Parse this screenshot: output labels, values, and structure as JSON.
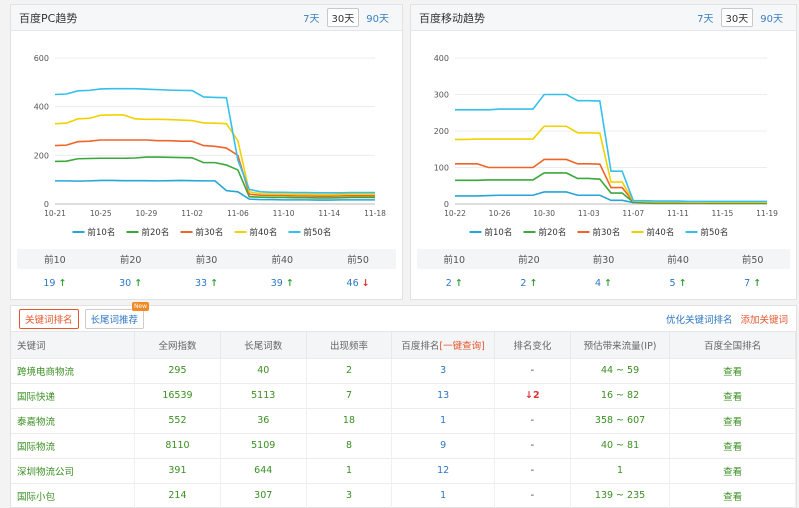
{
  "pc_panel": {
    "title": "百度PC趋势",
    "ranges": [
      "7天",
      "30天",
      "90天"
    ],
    "active_range": "30天",
    "rank_headers": [
      "前10",
      "前20",
      "前30",
      "前40",
      "前50"
    ],
    "rank_values": [
      {
        "value": "19",
        "trend": "up"
      },
      {
        "value": "30",
        "trend": "up"
      },
      {
        "value": "33",
        "trend": "up"
      },
      {
        "value": "39",
        "trend": "up"
      },
      {
        "value": "46",
        "trend": "down"
      }
    ]
  },
  "mobile_panel": {
    "title": "百度移动趋势",
    "ranges": [
      "7天",
      "30天",
      "90天"
    ],
    "active_range": "30天",
    "rank_headers": [
      "前10",
      "前20",
      "前30",
      "前40",
      "前50"
    ],
    "rank_values": [
      {
        "value": "2",
        "trend": "up"
      },
      {
        "value": "2",
        "trend": "up"
      },
      {
        "value": "4",
        "trend": "up"
      },
      {
        "value": "5",
        "trend": "up"
      },
      {
        "value": "7",
        "trend": "up"
      }
    ]
  },
  "chart_data": [
    {
      "type": "line",
      "x": [
        "10-21",
        "10-22",
        "10-23",
        "10-24",
        "10-25",
        "10-26",
        "10-27",
        "10-28",
        "10-29",
        "10-30",
        "10-31",
        "11-01",
        "11-02",
        "11-03",
        "11-04",
        "11-05",
        "11-06",
        "11-07",
        "11-08",
        "11-09",
        "11-10",
        "11-11",
        "11-12",
        "11-13",
        "11-14",
        "11-15",
        "11-16",
        "11-17",
        "11-18"
      ],
      "x_ticks": [
        "10-21",
        "10-25",
        "10-29",
        "11-02",
        "11-06",
        "11-10",
        "11-14",
        "11-18"
      ],
      "ylim": [
        0,
        600
      ],
      "y_ticks": [
        0,
        200,
        400,
        600
      ],
      "series": [
        {
          "name": "前10名",
          "color": "#26a6d6",
          "values": [
            95,
            95,
            94,
            95,
            97,
            97,
            96,
            96,
            96,
            95,
            96,
            97,
            96,
            95,
            95,
            55,
            50,
            20,
            18,
            18,
            17,
            17,
            17,
            16,
            16,
            17,
            17,
            17,
            17
          ]
        },
        {
          "name": "前20名",
          "color": "#3aa83a",
          "values": [
            175,
            176,
            186,
            187,
            188,
            188,
            188,
            189,
            193,
            193,
            192,
            191,
            190,
            170,
            170,
            160,
            140,
            30,
            28,
            27,
            27,
            26,
            26,
            25,
            25,
            26,
            27,
            27,
            27
          ]
        },
        {
          "name": "前30名",
          "color": "#f0642a",
          "values": [
            240,
            242,
            256,
            258,
            263,
            263,
            263,
            263,
            263,
            260,
            260,
            258,
            258,
            240,
            237,
            230,
            200,
            40,
            36,
            35,
            35,
            33,
            33,
            32,
            32,
            33,
            34,
            34,
            34
          ]
        },
        {
          "name": "前40名",
          "color": "#f0d200",
          "values": [
            330,
            332,
            350,
            352,
            365,
            366,
            366,
            350,
            348,
            348,
            347,
            345,
            343,
            333,
            332,
            330,
            260,
            50,
            42,
            41,
            41,
            40,
            40,
            39,
            39,
            40,
            41,
            41,
            41
          ]
        },
        {
          "name": "前50名",
          "color": "#35c0ec",
          "values": [
            450,
            452,
            465,
            467,
            473,
            474,
            474,
            474,
            472,
            470,
            468,
            467,
            466,
            440,
            438,
            437,
            180,
            60,
            50,
            48,
            48,
            47,
            47,
            46,
            46,
            46,
            47,
            47,
            47
          ]
        }
      ]
    },
    {
      "type": "line",
      "x": [
        "10-22",
        "10-23",
        "10-24",
        "10-25",
        "10-26",
        "10-27",
        "10-28",
        "10-29",
        "10-30",
        "10-31",
        "11-01",
        "11-02",
        "11-03",
        "11-04",
        "11-05",
        "11-06",
        "11-07",
        "11-08",
        "11-09",
        "11-10",
        "11-11",
        "11-12",
        "11-13",
        "11-14",
        "11-15",
        "11-16",
        "11-17",
        "11-18",
        "11-19"
      ],
      "x_ticks": [
        "10-22",
        "10-26",
        "10-30",
        "11-03",
        "11-07",
        "11-11",
        "11-15",
        "11-19"
      ],
      "ylim": [
        0,
        400
      ],
      "y_ticks": [
        0,
        100,
        200,
        300,
        400
      ],
      "series": [
        {
          "name": "前10名",
          "color": "#26a6d6",
          "values": [
            22,
            22,
            22,
            23,
            24,
            24,
            24,
            24,
            33,
            33,
            33,
            24,
            24,
            24,
            10,
            10,
            4,
            3,
            2,
            2,
            2,
            2,
            2,
            2,
            2,
            2,
            2,
            2,
            2
          ]
        },
        {
          "name": "前20名",
          "color": "#3aa83a",
          "values": [
            65,
            65,
            65,
            66,
            66,
            66,
            66,
            66,
            85,
            85,
            85,
            70,
            70,
            68,
            30,
            30,
            5,
            4,
            3,
            3,
            3,
            3,
            3,
            2,
            2,
            2,
            2,
            2,
            2
          ]
        },
        {
          "name": "前30名",
          "color": "#f0642a",
          "values": [
            110,
            110,
            110,
            100,
            100,
            100,
            100,
            100,
            122,
            122,
            122,
            110,
            110,
            109,
            45,
            45,
            7,
            6,
            5,
            5,
            5,
            4,
            4,
            4,
            4,
            4,
            4,
            4,
            4
          ]
        },
        {
          "name": "前40名",
          "color": "#f0d200",
          "values": [
            177,
            177,
            178,
            178,
            178,
            178,
            178,
            178,
            213,
            213,
            213,
            195,
            195,
            194,
            60,
            60,
            8,
            7,
            6,
            6,
            6,
            5,
            5,
            5,
            5,
            5,
            5,
            5,
            5
          ]
        },
        {
          "name": "前50名",
          "color": "#35c0ec",
          "values": [
            258,
            258,
            258,
            258,
            260,
            260,
            260,
            260,
            300,
            300,
            300,
            283,
            283,
            282,
            90,
            90,
            9,
            9,
            8,
            8,
            8,
            7,
            7,
            7,
            7,
            7,
            7,
            7,
            7
          ]
        }
      ]
    }
  ],
  "keywords": {
    "tabs": [
      "关键词排名",
      "长尾词推荐"
    ],
    "new_badge": "New",
    "link_optimize": "优化关键词排名",
    "link_add": "添加关键词",
    "headers": [
      "关键词",
      "全网指数",
      "长尾词数",
      "出现频率",
      "百度排名",
      "[一键查询]",
      "排名变化",
      "预估带来流量(IP)",
      "百度全国排名"
    ],
    "rows": [
      {
        "keyword": "跨境电商物流",
        "index": "295",
        "longtail": "40",
        "freq": "2",
        "rank": "3",
        "change": "-",
        "change_dir": "none",
        "traffic": "44 ~ 59",
        "action": "查看"
      },
      {
        "keyword": "国际快递",
        "index": "16539",
        "longtail": "5113",
        "freq": "7",
        "rank": "13",
        "change": "2",
        "change_dir": "down",
        "traffic": "16 ~ 82",
        "action": "查看"
      },
      {
        "keyword": "泰嘉物流",
        "index": "552",
        "longtail": "36",
        "freq": "18",
        "rank": "1",
        "change": "-",
        "change_dir": "none",
        "traffic": "358 ~ 607",
        "action": "查看"
      },
      {
        "keyword": "国际物流",
        "index": "8110",
        "longtail": "5109",
        "freq": "8",
        "rank": "9",
        "change": "-",
        "change_dir": "none",
        "traffic": "40 ~ 81",
        "action": "查看"
      },
      {
        "keyword": "深圳物流公司",
        "index": "391",
        "longtail": "644",
        "freq": "1",
        "rank": "12",
        "change": "-",
        "change_dir": "none",
        "traffic": "1",
        "action": "查看"
      },
      {
        "keyword": "国际小包",
        "index": "214",
        "longtail": "307",
        "freq": "3",
        "rank": "1",
        "change": "-",
        "change_dir": "none",
        "traffic": "139 ~ 235",
        "action": "查看"
      }
    ]
  }
}
